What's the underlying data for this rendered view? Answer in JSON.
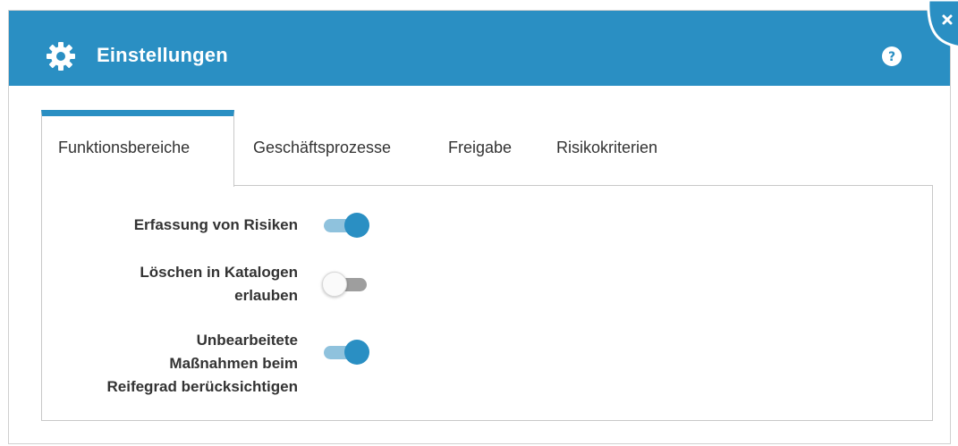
{
  "dialog": {
    "title": "Einstellungen",
    "icons": {
      "title_icon": "gear-icon",
      "help": "help-icon",
      "close": "close-icon"
    },
    "colors": {
      "accent": "#2a8fc3",
      "toggle_on_track": "#8fc2dd",
      "toggle_off_track": "#9e9e9e"
    }
  },
  "tabs": [
    {
      "label": "Funktionsbereiche",
      "active": true
    },
    {
      "label": "Geschäftsprozesse",
      "active": false
    },
    {
      "label": "Freigabe",
      "active": false
    },
    {
      "label": "Risikokriterien",
      "active": false
    }
  ],
  "settings": [
    {
      "label_lines": [
        "Erfassung von Risiken"
      ],
      "enabled": true
    },
    {
      "label_lines": [
        "Löschen in Katalogen",
        "erlauben"
      ],
      "enabled": false
    },
    {
      "label_lines": [
        "Unbearbeitete",
        "Maßnahmen beim",
        "Reifegrad berücksichtigen"
      ],
      "enabled": true
    }
  ]
}
